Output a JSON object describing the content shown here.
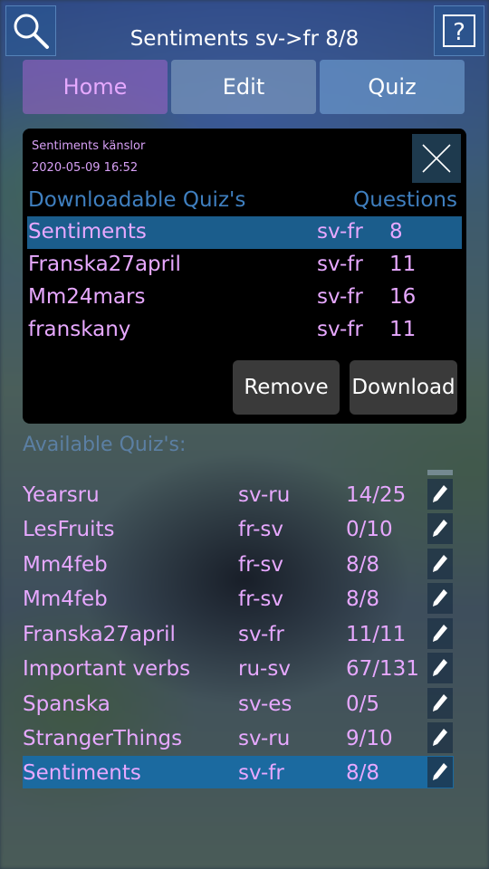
{
  "header": {
    "title": "Sentiments sv->fr 8/8",
    "search_icon": "search-icon",
    "help_icon": "help-icon"
  },
  "tabs": [
    {
      "label": "Home",
      "active": true
    },
    {
      "label": "Edit",
      "active": false
    },
    {
      "label": "Quiz",
      "active": false
    }
  ],
  "download_panel": {
    "info_name": "Sentiments känslor",
    "info_date": "2020-05-09  16:52",
    "header_name": "Downloadable Quiz's",
    "header_questions": "Questions",
    "rows": [
      {
        "name": "Sentiments",
        "lang": "sv-fr",
        "count": "8",
        "selected": true
      },
      {
        "name": "Franska27april",
        "lang": "sv-fr",
        "count": "11",
        "selected": false
      },
      {
        "name": "Mm24mars",
        "lang": "sv-fr",
        "count": "16",
        "selected": false
      },
      {
        "name": "franskany",
        "lang": "sv-fr",
        "count": "11",
        "selected": false
      }
    ],
    "remove_label": "Remove",
    "download_label": "Download"
  },
  "available": {
    "label": "Available Quiz's:",
    "rows": [
      {
        "name": "Yearsru",
        "lang": "sv-ru",
        "progress": "14/25",
        "selected": false
      },
      {
        "name": "LesFruits",
        "lang": "fr-sv",
        "progress": "0/10",
        "selected": false
      },
      {
        "name": "Mm4feb",
        "lang": "fr-sv",
        "progress": "8/8",
        "selected": false
      },
      {
        "name": "Mm4feb",
        "lang": "fr-sv",
        "progress": "8/8",
        "selected": false
      },
      {
        "name": "Franska27april",
        "lang": "sv-fr",
        "progress": "11/11",
        "selected": false
      },
      {
        "name": "Important verbs",
        "lang": "ru-sv",
        "progress": "67/131",
        "selected": false
      },
      {
        "name": "Spanska",
        "lang": "sv-es",
        "progress": "0/5",
        "selected": false
      },
      {
        "name": "StrangerThings",
        "lang": "sv-ru",
        "progress": "9/10",
        "selected": false
      },
      {
        "name": "Sentiments",
        "lang": "sv-fr",
        "progress": "8/8",
        "selected": true
      }
    ]
  },
  "colors": {
    "accent_text": "#e7a8ff",
    "selected_row": "#1b5d8c",
    "header_blue": "#3f7fbf"
  }
}
